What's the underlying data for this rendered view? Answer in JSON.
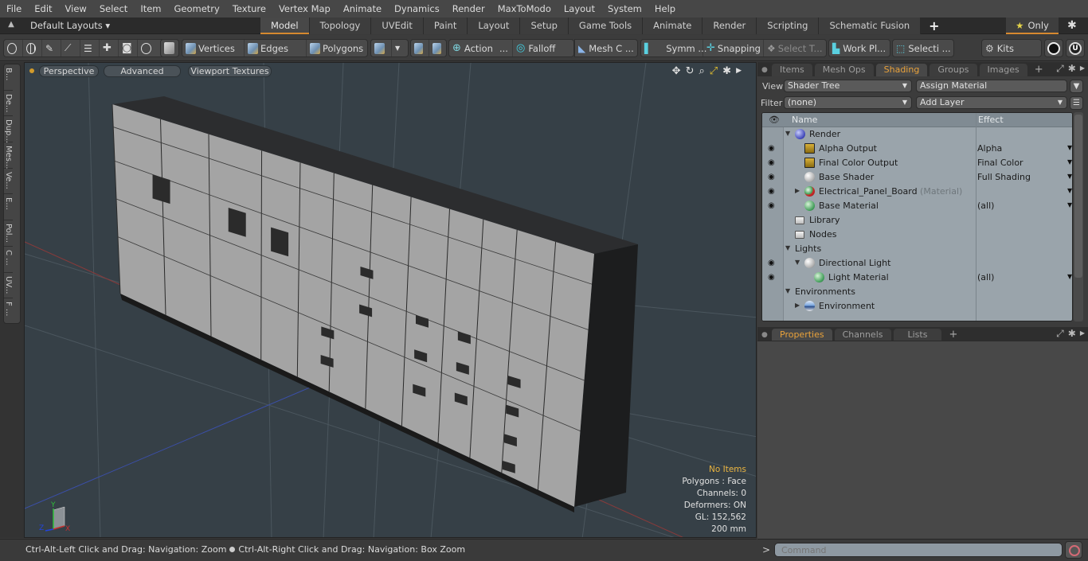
{
  "menubar": [
    "File",
    "Edit",
    "View",
    "Select",
    "Item",
    "Geometry",
    "Texture",
    "Vertex Map",
    "Animate",
    "Dynamics",
    "Render",
    "MaxToModo",
    "Layout",
    "System",
    "Help"
  ],
  "layoutbar": {
    "layouts_label": "Default Layouts ▾",
    "tabs": [
      "Model",
      "Topology",
      "UVEdit",
      "Paint",
      "Layout",
      "Setup",
      "Game Tools",
      "Animate",
      "Render",
      "Scripting",
      "Schematic Fusion"
    ],
    "active_tab": "Model",
    "add_tab": "+",
    "only_label": "Only",
    "accent": "#d6892f"
  },
  "toolbar": {
    "vertices": "Vertices",
    "edges": "Edges",
    "polygons": "Polygons",
    "action": "Action",
    "action_more": "...",
    "falloff": "Falloff",
    "mesh_c": "Mesh C ...",
    "symm": "Symm ...",
    "snapping": "Snapping",
    "select_t": "Select T...",
    "work_pl": "Work Pl...",
    "selecti": "Selecti ...",
    "kits": "Kits"
  },
  "left_tabs": [
    "B...",
    "De...",
    "Dup...",
    "Mes...",
    "Ve...",
    "E...",
    "Pol...",
    "C ...",
    "UV...",
    "F ..."
  ],
  "viewport": {
    "view_mode": "Perspective",
    "shading": "Advanced",
    "textures": "Viewport Textures",
    "info": {
      "selection": "No Items",
      "mode": "Polygons : Face",
      "channels": "Channels: 0",
      "deformers": "Deformers: ON",
      "gl": "GL: 152,562",
      "grid": "200 mm"
    }
  },
  "statusbar": {
    "hint1": "Ctrl-Alt-Left Click and Drag: Navigation: Zoom",
    "hint2": "Ctrl-Alt-Right Click and Drag: Navigation: Box Zoom"
  },
  "right_panel": {
    "tabs": [
      "Items",
      "Mesh Ops",
      "Shading",
      "Groups",
      "Images"
    ],
    "active_tab": "Shading",
    "add_tab": "+",
    "view_label": "View",
    "view_value": "Shader Tree",
    "assign_material": "Assign Material",
    "filter_label": "Filter",
    "filter_value": "(none)",
    "add_layer": "Add Layer",
    "columns": {
      "name": "Name",
      "effect": "Effect"
    },
    "tree": [
      {
        "name": "Render",
        "icon": "sphere-blue",
        "effect": "",
        "eye": false,
        "level": 0,
        "twisty": "open"
      },
      {
        "name": "Alpha Output",
        "icon": "image",
        "effect": "Alpha",
        "eye": true,
        "level": 1
      },
      {
        "name": "Final Color Output",
        "icon": "image",
        "effect": "Final Color",
        "eye": true,
        "level": 1
      },
      {
        "name": "Base Shader",
        "icon": "sphere-white",
        "effect": "Full Shading",
        "eye": true,
        "level": 1
      },
      {
        "name": "Electrical_Panel_Board",
        "suffix": "(Material)",
        "icon": "sphere-red",
        "effect": "",
        "eye": true,
        "level": 1,
        "twisty": "closed",
        "dropdown": true
      },
      {
        "name": "Base Material",
        "icon": "sphere-green",
        "effect": "(all)",
        "eye": true,
        "level": 1
      },
      {
        "name": "Library",
        "icon": "folder",
        "effect": "",
        "eye": false,
        "level": 0
      },
      {
        "name": "Nodes",
        "icon": "folder",
        "effect": "",
        "eye": false,
        "level": 0
      },
      {
        "name": "Lights",
        "icon": "",
        "effect": "",
        "eye": false,
        "level": 0,
        "twisty": "open"
      },
      {
        "name": "Directional Light",
        "icon": "light",
        "effect": "",
        "eye": true,
        "level": 1,
        "twisty": "open"
      },
      {
        "name": "Light Material",
        "icon": "sphere-green",
        "effect": "(all)",
        "eye": true,
        "level": 2
      },
      {
        "name": "Environments",
        "icon": "",
        "effect": "",
        "eye": false,
        "level": 0,
        "twisty": "open"
      },
      {
        "name": "Environment",
        "icon": "sphere-env",
        "effect": "",
        "eye": false,
        "level": 1,
        "twisty": "closed"
      }
    ],
    "bottom_tabs": [
      "Properties",
      "Channels",
      "Lists"
    ],
    "bottom_active": "Properties",
    "active_color": "#e9a23b"
  },
  "command": {
    "prompt": ">",
    "placeholder": "Command"
  }
}
